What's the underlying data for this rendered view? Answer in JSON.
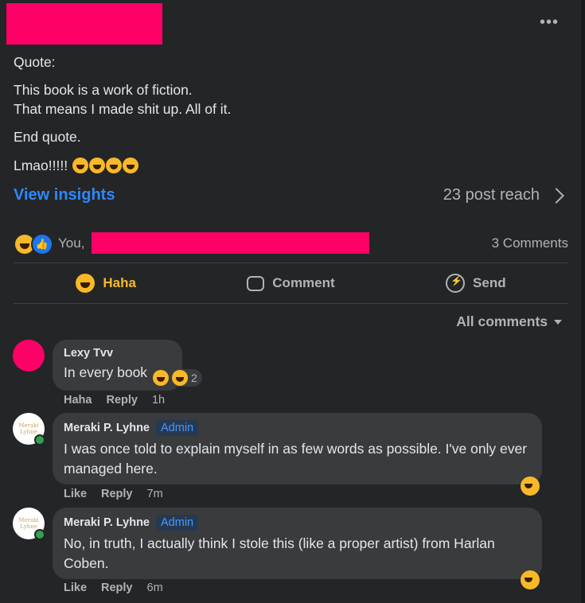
{
  "post": {
    "more_icon": "more-horizontal-icon",
    "lines": [
      "Quote:",
      "This book is a work of fiction.",
      "That means I made shit up. All of it.",
      "End quote.",
      "Lmao!!!!!"
    ],
    "insights_label": "View insights",
    "reach_label": "23 post reach",
    "reactors_prefix": "You,",
    "comments_count": "3 Comments"
  },
  "actions": {
    "haha": "Haha",
    "comment": "Comment",
    "send": "Send"
  },
  "sort_label": "All comments",
  "comments": [
    {
      "author": "Lexy Tvv",
      "text": "In every book",
      "react_count": "2",
      "actions": [
        "Haha",
        "Reply"
      ],
      "time": "1h"
    },
    {
      "author": "Meraki P. Lyhne",
      "badge": "Admin",
      "text": "I was once told to explain myself in as few words as possible. I've only ever managed here.",
      "actions": [
        "Like",
        "Reply"
      ],
      "time": "7m"
    },
    {
      "author": "Meraki P. Lyhne",
      "badge": "Admin",
      "text": "No, in truth, I actually think I stole this (like a proper artist) from Harlan Coben.",
      "actions": [
        "Like",
        "Reply"
      ],
      "time": "6m"
    }
  ],
  "avatar_logo_text": "Meraki Lyhne"
}
